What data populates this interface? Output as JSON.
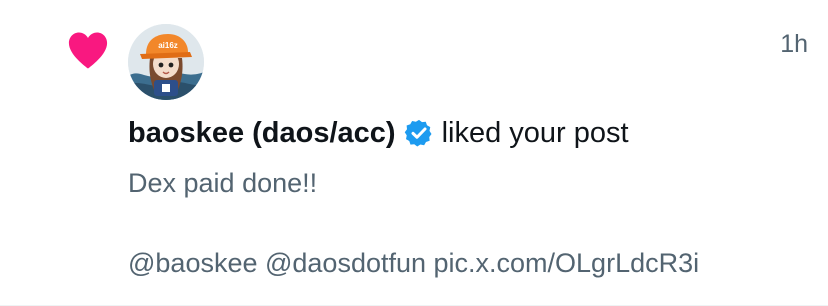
{
  "notification": {
    "type_icon": "heart-icon",
    "timestamp": "1h",
    "user": {
      "display_name": "baoskee (daos/acc)",
      "verified_icon": "verified-badge-icon",
      "avatar_hat_text": "ai16z"
    },
    "action": "liked your post",
    "post": {
      "text": "Dex paid done!!",
      "links": "@baoskee @daosdotfun pic.x.com/OLgrLdcR3i"
    }
  },
  "colors": {
    "heart": "#f91880",
    "verified": "#1d9bf0",
    "secondary_text": "#536471",
    "primary_text": "#0f1419"
  }
}
